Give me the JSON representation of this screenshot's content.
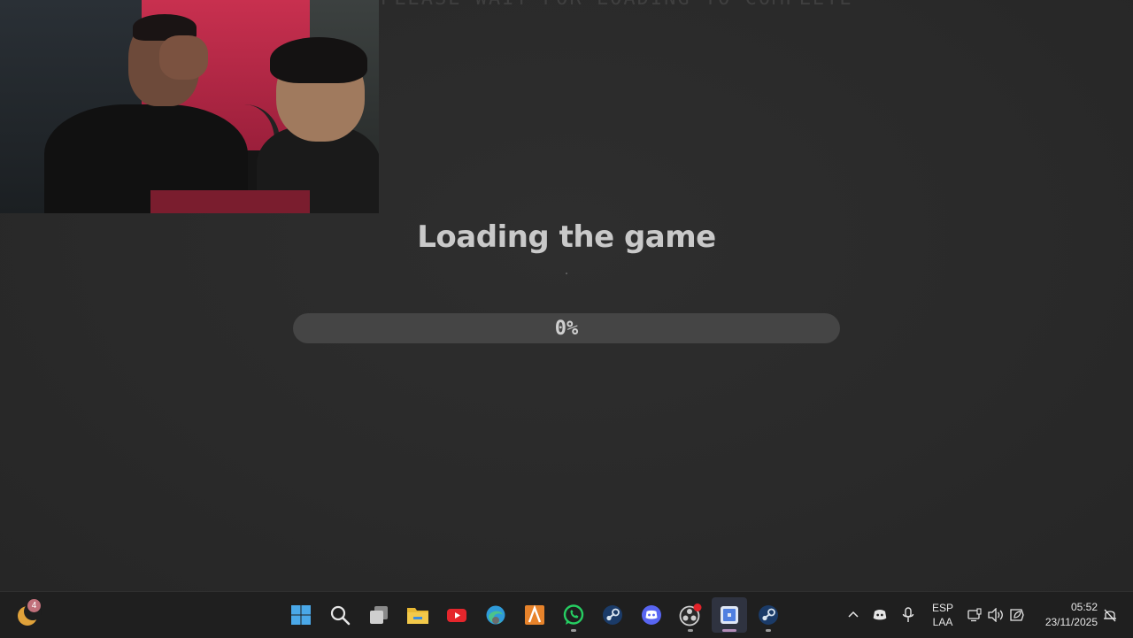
{
  "screen": {
    "banner": "PLEASE WAIT FOR LOADING TO COMPLETE",
    "loading_title": "Loading the game",
    "progress": {
      "value": 0,
      "label": "0%"
    }
  },
  "taskbar": {
    "widget_badge": "4",
    "apps": [
      {
        "icon": "windows-start-icon",
        "active": false
      },
      {
        "icon": "search-icon",
        "active": false
      },
      {
        "icon": "task-view-icon",
        "active": false
      },
      {
        "icon": "file-explorer-icon",
        "active": false
      },
      {
        "icon": "youtube-icon",
        "active": false
      },
      {
        "icon": "edge-icon",
        "active": false
      },
      {
        "icon": "arc-app-icon",
        "active": false
      },
      {
        "icon": "whatsapp-icon",
        "active": false,
        "running": true
      },
      {
        "icon": "steam-icon",
        "active": false
      },
      {
        "icon": "discord-icon",
        "active": false
      },
      {
        "icon": "obs-icon",
        "active": false,
        "running": true
      },
      {
        "icon": "roblox-icon",
        "active": true,
        "running": true
      },
      {
        "icon": "steam-icon",
        "active": false,
        "running": true
      }
    ],
    "tray": {
      "lang_top": "ESP",
      "lang_bottom": "LAA",
      "time": "05:52",
      "date": "23/11/2025"
    }
  },
  "colors": {
    "background": "#2a2a2a",
    "taskbar": "#1f1f1f",
    "progress_track": "#454545",
    "title_text": "#c9c9c9"
  }
}
